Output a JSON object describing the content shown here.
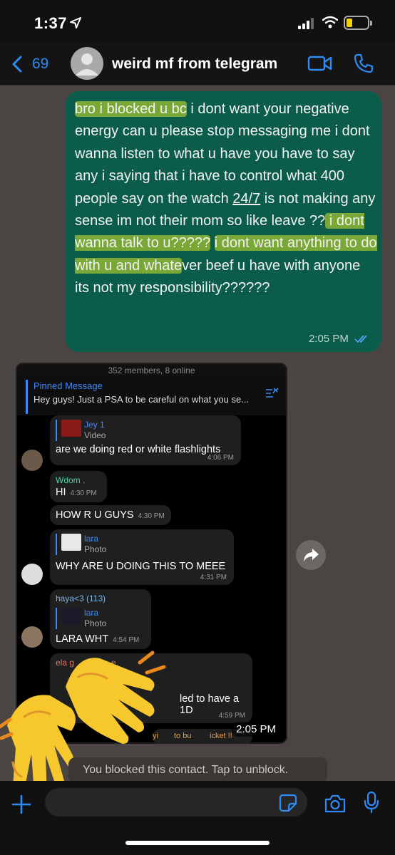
{
  "status_bar": {
    "time": "1:37"
  },
  "header": {
    "back_count": "69",
    "contact_name": "weird mf from telegram"
  },
  "outgoing": {
    "segments": [
      "bro i blocked u bc",
      " i dont want your negative energy can u please stop messaging me i dont wanna listen to what u have you have to say any i saying that i have to control what 400 people say on the watch ",
      "24/7",
      " is not making any sense im not their mom so like leave ??",
      " i dont wanna talk to u?????",
      " ",
      "i dont want anything to do with u and whate",
      "ver beef u have with anyone its not my responsibility??????"
    ],
    "time": "2:05 PM"
  },
  "screenshot": {
    "top_text": "352 members, 8 online",
    "pinned_title": "Pinned Message",
    "pinned_text": "Hey guys! Just a PSA to be careful on what you se...",
    "messages": [
      {
        "reply_name": "Jey 1",
        "reply_kind": "Video",
        "text": "are we doing red or white flashlights",
        "time": "4:06 PM"
      },
      {
        "sender": "Wdom .",
        "text": "HI",
        "time": "4:30 PM"
      },
      {
        "text": "HOW R U GUYS",
        "time": "4:30 PM"
      },
      {
        "reply_name": "lara",
        "reply_kind": "Photo",
        "text": "WHY ARE U DOING THIS TO MEEE",
        "time": "4:31 PM"
      },
      {
        "sender": "haya<3 (113)",
        "reply_name": "lara",
        "reply_kind": "Photo",
        "text": "LARA WHT",
        "time": "4:54 PM"
      },
      {
        "sender": "ela g",
        "sender_tail": "e",
        "text": "led to have a 1D",
        "time": "4:59 PM"
      },
      {
        "text": "yi",
        "text_b": "to bu",
        "text_c": "icket !!"
      }
    ],
    "image_time": "2:05 PM"
  },
  "blocked_notice": "You blocked this contact. Tap to unblock.",
  "composer": {
    "placeholder": ""
  },
  "colors": {
    "background": "#4a4543",
    "outgoing_bubble": "#0b5c4b",
    "highlight": "#d6e828",
    "accent": "#2f8bf5",
    "telegram_link": "#3d8af7"
  },
  "icons": [
    "location-arrow-icon",
    "signal-icon",
    "wifi-icon",
    "battery-icon",
    "back-chevron-icon",
    "video-call-icon",
    "phone-icon",
    "forward-icon",
    "raising-hands-emoji",
    "plus-icon",
    "sticker-icon",
    "camera-icon",
    "microphone-icon"
  ]
}
